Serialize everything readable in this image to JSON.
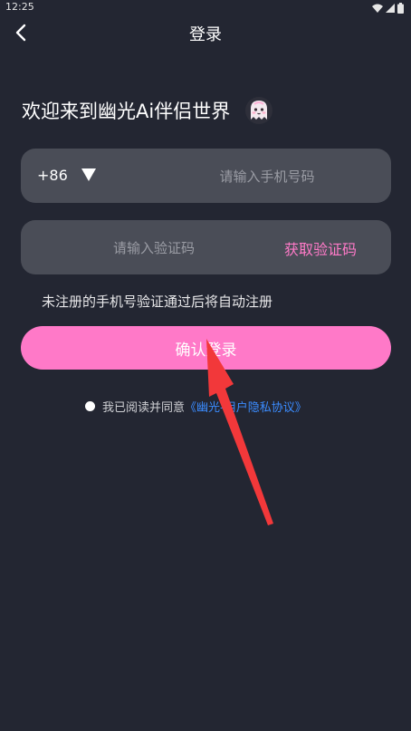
{
  "status_bar": {
    "time": "12:25",
    "icons": [
      "wifi-icon",
      "signal-icon",
      "battery-icon"
    ]
  },
  "nav": {
    "back_icon": "chevron-left-icon",
    "title": "登录"
  },
  "welcome": {
    "text": "欢迎来到幽光Ai伴侣世界",
    "icon": "ghost-mascot-icon"
  },
  "phone": {
    "country_code": "+86",
    "dropdown_icon": "triangle-down-icon",
    "placeholder": "请输入手机号码",
    "value": ""
  },
  "code": {
    "placeholder": "请输入验证码",
    "value": "",
    "get_code_label": "获取验证码"
  },
  "notice": "未注册的手机号验证通过后将自动注册",
  "confirm_label": "确认登录",
  "agreement": {
    "prefix": "我已阅读并同意",
    "link": "《幽光-用户隐私协议》",
    "checked": false
  },
  "colors": {
    "background": "#232632",
    "field": "#4a4d57",
    "accent_pink": "#ff79c8",
    "link_blue": "#3b8cff",
    "arrow_red": "#f2383a"
  }
}
